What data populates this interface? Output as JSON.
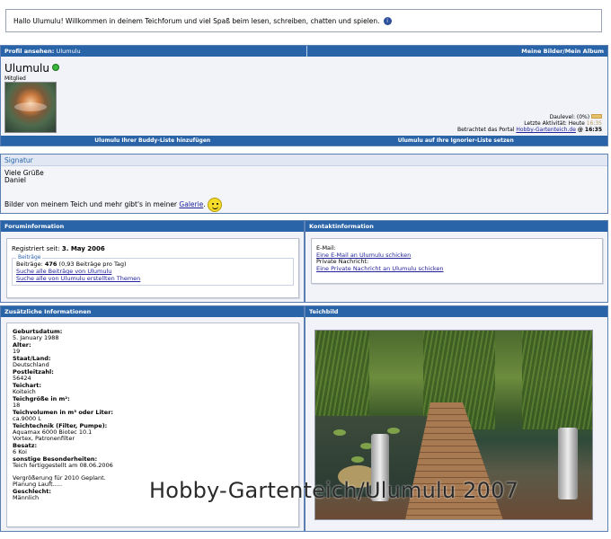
{
  "welcome": {
    "text": "Hallo Ulumulu! Willkommen in deinem Teichforum und viel Spaß beim lesen, schreiben, chatten und spielen.",
    "icon": "info-icon"
  },
  "profile": {
    "header_label": "Profil ansehen",
    "header_name": "Ulumulu",
    "header_right": "Meine Bilder/Mein Album",
    "username": "Ulumulu",
    "rank": "Mitglied",
    "daulevel": "Daulevel: (0%)",
    "last_activity_label": "Letzte Aktivität: Heute",
    "last_activity_time": "16:35",
    "portal_prefix": "Betrachtet das Portal",
    "portal_link": "Hobby-Gartenteich.de",
    "portal_time": "@ 16:35",
    "buddy_button": "Ulumulu Ihrer Buddy-Liste hinzufügen",
    "ignore_button": "Ulumulu auf Ihre Ignorier-Liste setzen"
  },
  "signature": {
    "title": "Signatur",
    "line1": "Viele Grüße",
    "line2": "Daniel",
    "gallery_text": "Bilder von meinem Teich und mehr gibt's in meiner",
    "gallery_link": "Galerie",
    "gallery_end": "."
  },
  "forum_info": {
    "title": "Foruminformation",
    "registered_label": "Registriert seit:",
    "registered_date": "3. May 2006",
    "posts_legend": "Beiträge",
    "posts_label": "Beiträge:",
    "posts_count": "476",
    "posts_rate": "(0,93 Beiträge pro Tag)",
    "search_posts": "Suche alle Beiträge von Ulumulu",
    "search_threads": "Suche alle von Ulumulu erstellten Themen"
  },
  "contact_info": {
    "title": "Kontaktinformation",
    "email_label": "E-Mail:",
    "email_link": "Eine E-Mail an Ulumulu schicken",
    "pm_label": "Private Nachricht:",
    "pm_link": "Eine Private Nachricht an Ulumulu schicken"
  },
  "extra_info": {
    "title": "Zusätzliche Informationen",
    "fields": [
      {
        "k": "Geburtsdatum:",
        "v": "5. January 1988"
      },
      {
        "k": "Alter:",
        "v": "19"
      },
      {
        "k": "Staat/Land:",
        "v": "Deutschland"
      },
      {
        "k": "Postleitzahl:",
        "v": "56424"
      },
      {
        "k": "Teichart:",
        "v": "Koiteich"
      },
      {
        "k": "Teichgröße in m²:",
        "v": "18"
      },
      {
        "k": "Teichvolumen in m³ oder Liter:",
        "v": "ca.9000 L"
      },
      {
        "k": "Teichtechnik (Filter, Pumpe):",
        "v": "Aquamax 6000 Biotec 10.1\nVortex, Patronenfilter"
      },
      {
        "k": "Besatz:",
        "v": "6 Koi"
      },
      {
        "k": "sonstige Besonderheiten:",
        "v": "Teich fertiggestellt am 08.06.2006\n\nVergrößerung für 2010 Geplant.\nPlanung Lauft....."
      },
      {
        "k": "Geschlecht:",
        "v": "Männlich"
      }
    ]
  },
  "teichbild": {
    "title": "Teichbild"
  },
  "watermark": "Hobby-Gartenteich/Ulumulu 2007"
}
